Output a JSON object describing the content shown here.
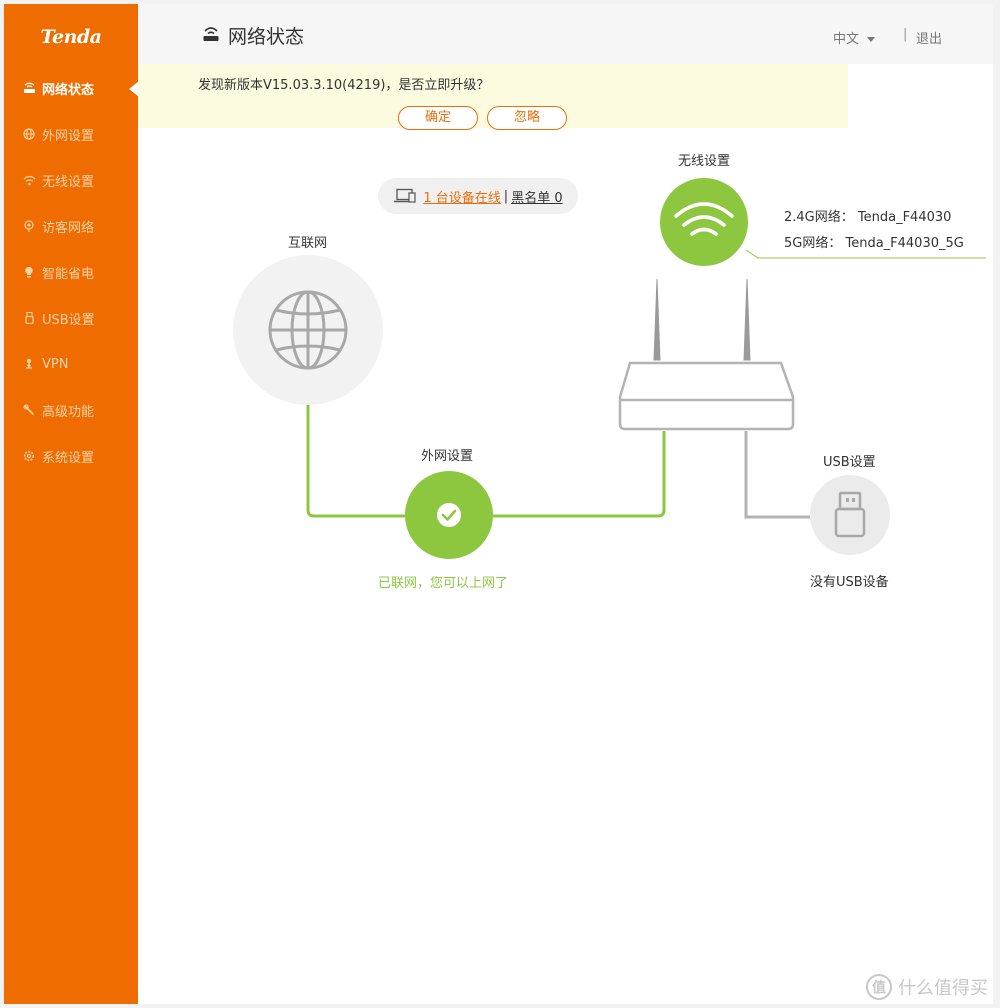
{
  "brand": {
    "logo": "Tenda"
  },
  "sidebar": {
    "items": [
      {
        "label": "网络状态",
        "icon": "router-icon",
        "active": true
      },
      {
        "label": "外网设置",
        "icon": "globe-icon",
        "active": false
      },
      {
        "label": "无线设置",
        "icon": "wifi-icon",
        "active": false
      },
      {
        "label": "访客网络",
        "icon": "guest-icon",
        "active": false
      },
      {
        "label": "智能省电",
        "icon": "bulb-icon",
        "active": false
      },
      {
        "label": "USB设置",
        "icon": "usb-icon",
        "active": false
      },
      {
        "label": "VPN",
        "icon": "vpn-icon",
        "active": false
      },
      {
        "label": "高级功能",
        "icon": "wrench-icon",
        "active": false
      },
      {
        "label": "系统设置",
        "icon": "gear-icon",
        "active": false
      }
    ]
  },
  "header": {
    "title": "网络状态",
    "language": "中文",
    "separator": "|",
    "logout": "退出"
  },
  "notice": {
    "text": "发现新版本V15.03.3.10(4219)，是否立即升级？",
    "confirm_label": "确定",
    "ignore_label": "忽略"
  },
  "devices": {
    "online_text": "1 台设备在线",
    "separator": "|",
    "blacklist_text": "黑名单 0"
  },
  "diagram": {
    "internet_label": "互联网",
    "wan_label": "外网设置",
    "wan_status": "已联网，您可以上网了",
    "wireless_label": "无线设置",
    "ssid_24": "2.4G网络： Tenda_F44030",
    "ssid_5": "5G网络： Tenda_F44030_5G",
    "usb_label": "USB设置",
    "usb_status": "没有USB设备"
  },
  "watermark": {
    "badge": "值",
    "text": "什么值得买"
  },
  "colors": {
    "sidebar": "#ee6c00",
    "accent": "#e96f0c",
    "green": "#8dc73f",
    "notice_bg": "#fcfbe0"
  }
}
